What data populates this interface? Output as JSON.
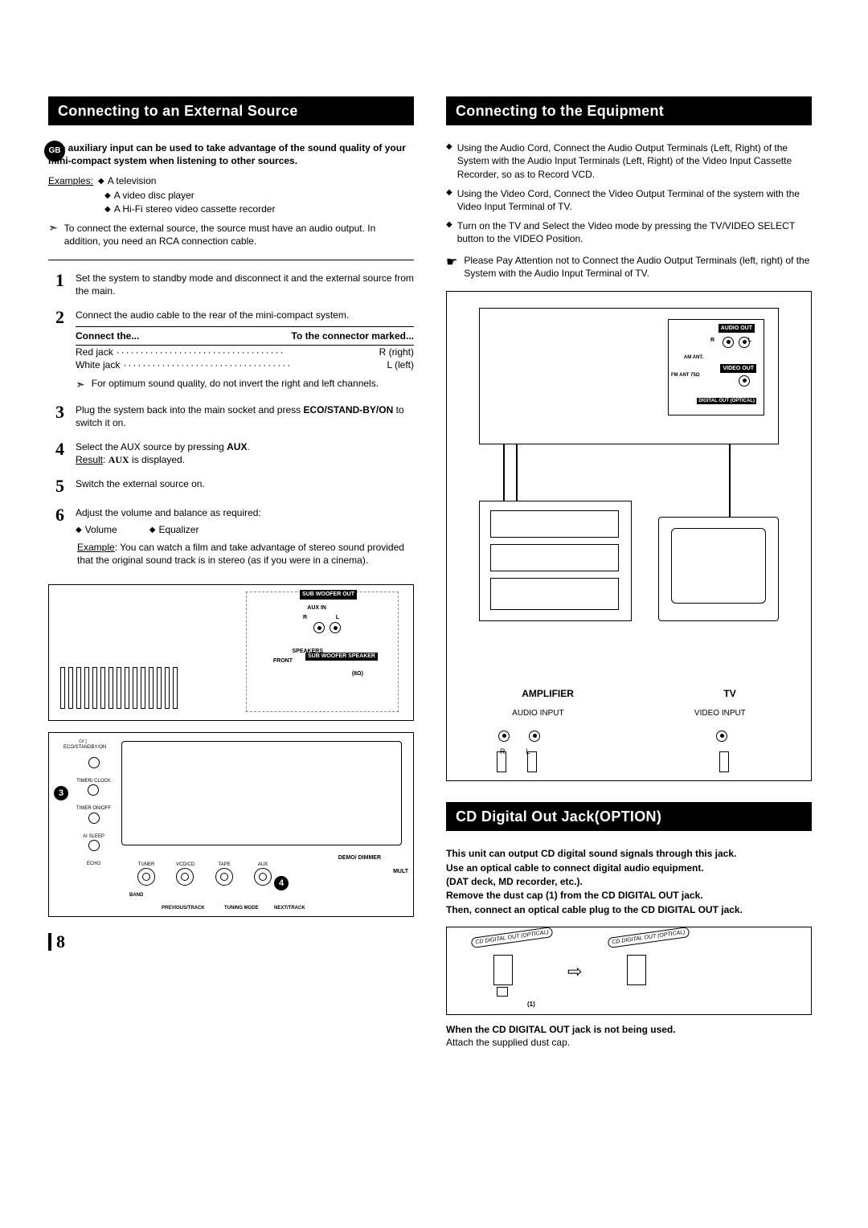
{
  "lang_badge": "GB",
  "page_number": "8",
  "left": {
    "heading": "Connecting to an External Source",
    "intro": "The auxiliary input can be used to take advantage of the sound quality of your mini-compact system when listening to other sources.",
    "examples_label": "Examples:",
    "examples": [
      "A television",
      "A video disc player",
      "A Hi-Fi stereo video cassette recorder"
    ],
    "arrow_note": "To connect the external source, the source must have an audio output. In addition, you need an RCA connection cable.",
    "steps": {
      "s1": "Set the system to standby mode and disconnect it and the external source from the main.",
      "s2": "Connect the audio cable to the rear of the mini-compact system.",
      "s2_table": {
        "head_left": "Connect the...",
        "head_right": "To the connector marked...",
        "rows": [
          {
            "l": "Red jack",
            "r": "R (right)"
          },
          {
            "l": "White jack",
            "r": "L (left)"
          }
        ]
      },
      "s2_note": "For optimum sound quality, do not invert the right and left channels.",
      "s3_a": "Plug the system back into the main socket and press ",
      "s3_btn": "ECO/STAND-BY/ON",
      "s3_b": " to switch it on.",
      "s4_a": "Select the AUX source by pressing ",
      "s4_btn": "AUX",
      "s4_b": ".",
      "s4_res_label": "Result",
      "s4_res_val": "AUX",
      "s4_res_tail": " is displayed.",
      "s5": "Switch the external source on.",
      "s6": "Adjust the volume and balance as required:",
      "s6_vol": "Volume",
      "s6_eq": "Equalizer",
      "s6_example_label": "Example",
      "s6_example": ": You can watch a film and take advantage of stereo sound provided that the original sound track is in stereo (as if you were in a cinema)."
    },
    "diagram1_labels": {
      "subwoofer_out": "SUB WOOFER OUT",
      "aux_in": "AUX IN",
      "r": "R",
      "l": "L",
      "speakers": "SPEAKERS",
      "front": "FRONT",
      "sub_speaker": "SUB WOOFER SPEAKER",
      "ohm": "(8Ω)"
    },
    "diagram2_labels": {
      "eco": "ECO/STANDBY/ON",
      "timer_clock": "TIMER/ CLOCK",
      "timer_onoff": "TIMER ON/OFF",
      "ai_sleep": "AI SLEEP",
      "echo": "ECHO",
      "tuner": "TUNER",
      "vcdcd": "VCD/CD",
      "tape": "TAPE",
      "aux": "AUX",
      "demo": "DEMO/ DIMMER",
      "mult": "MULT",
      "band": "BAND",
      "prev": "PREVIOUS/TRACK",
      "tuning": "TUNING MODE",
      "next": "NEXT/TRACK",
      "callout3": "3",
      "callout4": "4"
    }
  },
  "right": {
    "heading": "Connecting to the Equipment",
    "bullets": [
      "Using the Audio Cord, Connect the Audio Output Terminals (Left, Right) of the System with the Audio Input Terminals (Left, Right) of the Video Input Cassette Recorder, so as to Record VCD.",
      "Using the Video Cord, Connect the Video Output Terminal of the system with the Video Input Terminal of TV.",
      "Turn on the TV and Select the Video mode by pressing the TV/VIDEO SELECT button to the VIDEO Position."
    ],
    "hand_note": "Please Pay Attention not to Connect the Audio Output Terminals (left, right) of the System with the Audio Input Terminal of TV.",
    "diagram_labels": {
      "audio_out": "AUDIO OUT",
      "r": "R",
      "l": "L",
      "am_ant": "AM ANT.",
      "fm_ant": "FM ANT 75Ω",
      "video_out": "VIDEO OUT",
      "digital_out": "DIGITAL OUT (OPTICAL)",
      "amplifier": "AMPLIFIER",
      "tv": "TV",
      "audio_input": "AUDIO INPUT",
      "video_input": "VIDEO INPUT"
    },
    "cd_heading": "CD Digital Out Jack(OPTION)",
    "cd_intro": [
      "This unit can output CD digital sound signals through this jack.",
      "Use an optical cable to connect digital audio equipment.",
      "(DAT deck, MD recorder, etc.).",
      "Remove the dust cap (1) from the CD DIGITAL OUT jack.",
      "Then, connect an optical cable plug to the CD DIGITAL OUT jack."
    ],
    "cd_diagram": {
      "label": "CD DIGITAL OUT (OPTICAL)",
      "one": "(1)"
    },
    "cd_tail_bold": "When the CD DIGITAL OUT jack is not being used.",
    "cd_tail": "Attach the supplied dust cap."
  }
}
